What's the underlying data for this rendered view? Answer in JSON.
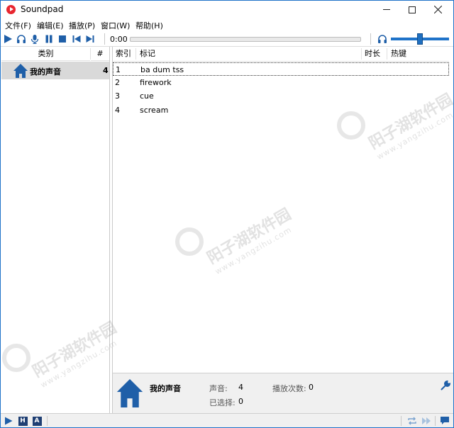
{
  "window": {
    "title": "Soundpad"
  },
  "menu": {
    "items": [
      "文件(F)",
      "编辑(E)",
      "播放(P)",
      "窗口(W)",
      "帮助(H)"
    ]
  },
  "toolbar": {
    "time": "0:00",
    "icons": [
      "play-icon",
      "headphones-icon",
      "microphone-icon",
      "pause-icon",
      "stop-icon",
      "previous-icon",
      "next-icon"
    ],
    "volume_level": 0.45
  },
  "categories": {
    "headers": {
      "name": "类别",
      "count": "#"
    },
    "items": [
      {
        "name": "我的声音",
        "count": "4",
        "icon": "home-icon"
      }
    ]
  },
  "sounds": {
    "headers": {
      "index": "索引",
      "tag": "标记",
      "duration": "时长",
      "hotkey": "热键"
    },
    "rows": [
      {
        "index": "1",
        "tag": "ba dum tss"
      },
      {
        "index": "2",
        "tag": "firework"
      },
      {
        "index": "3",
        "tag": "cue"
      },
      {
        "index": "4",
        "tag": "scream"
      }
    ]
  },
  "info": {
    "category_name": "我的声音",
    "sounds_label": "声音:",
    "sounds_value": "4",
    "plays_label": "播放次数:",
    "plays_value": "0",
    "selected_label": "已选择:",
    "selected_value": "0"
  },
  "statusbar": {
    "h_label": "H",
    "a_label": "A"
  },
  "watermark": {
    "text": "阳子湖软件园",
    "url": "www.yangzihu.com"
  },
  "colors": {
    "accent": "#1f73c9",
    "icon_blue": "#1f5fa8",
    "selected_row": "#d9d9d9",
    "app_icon": "#e8262f"
  }
}
